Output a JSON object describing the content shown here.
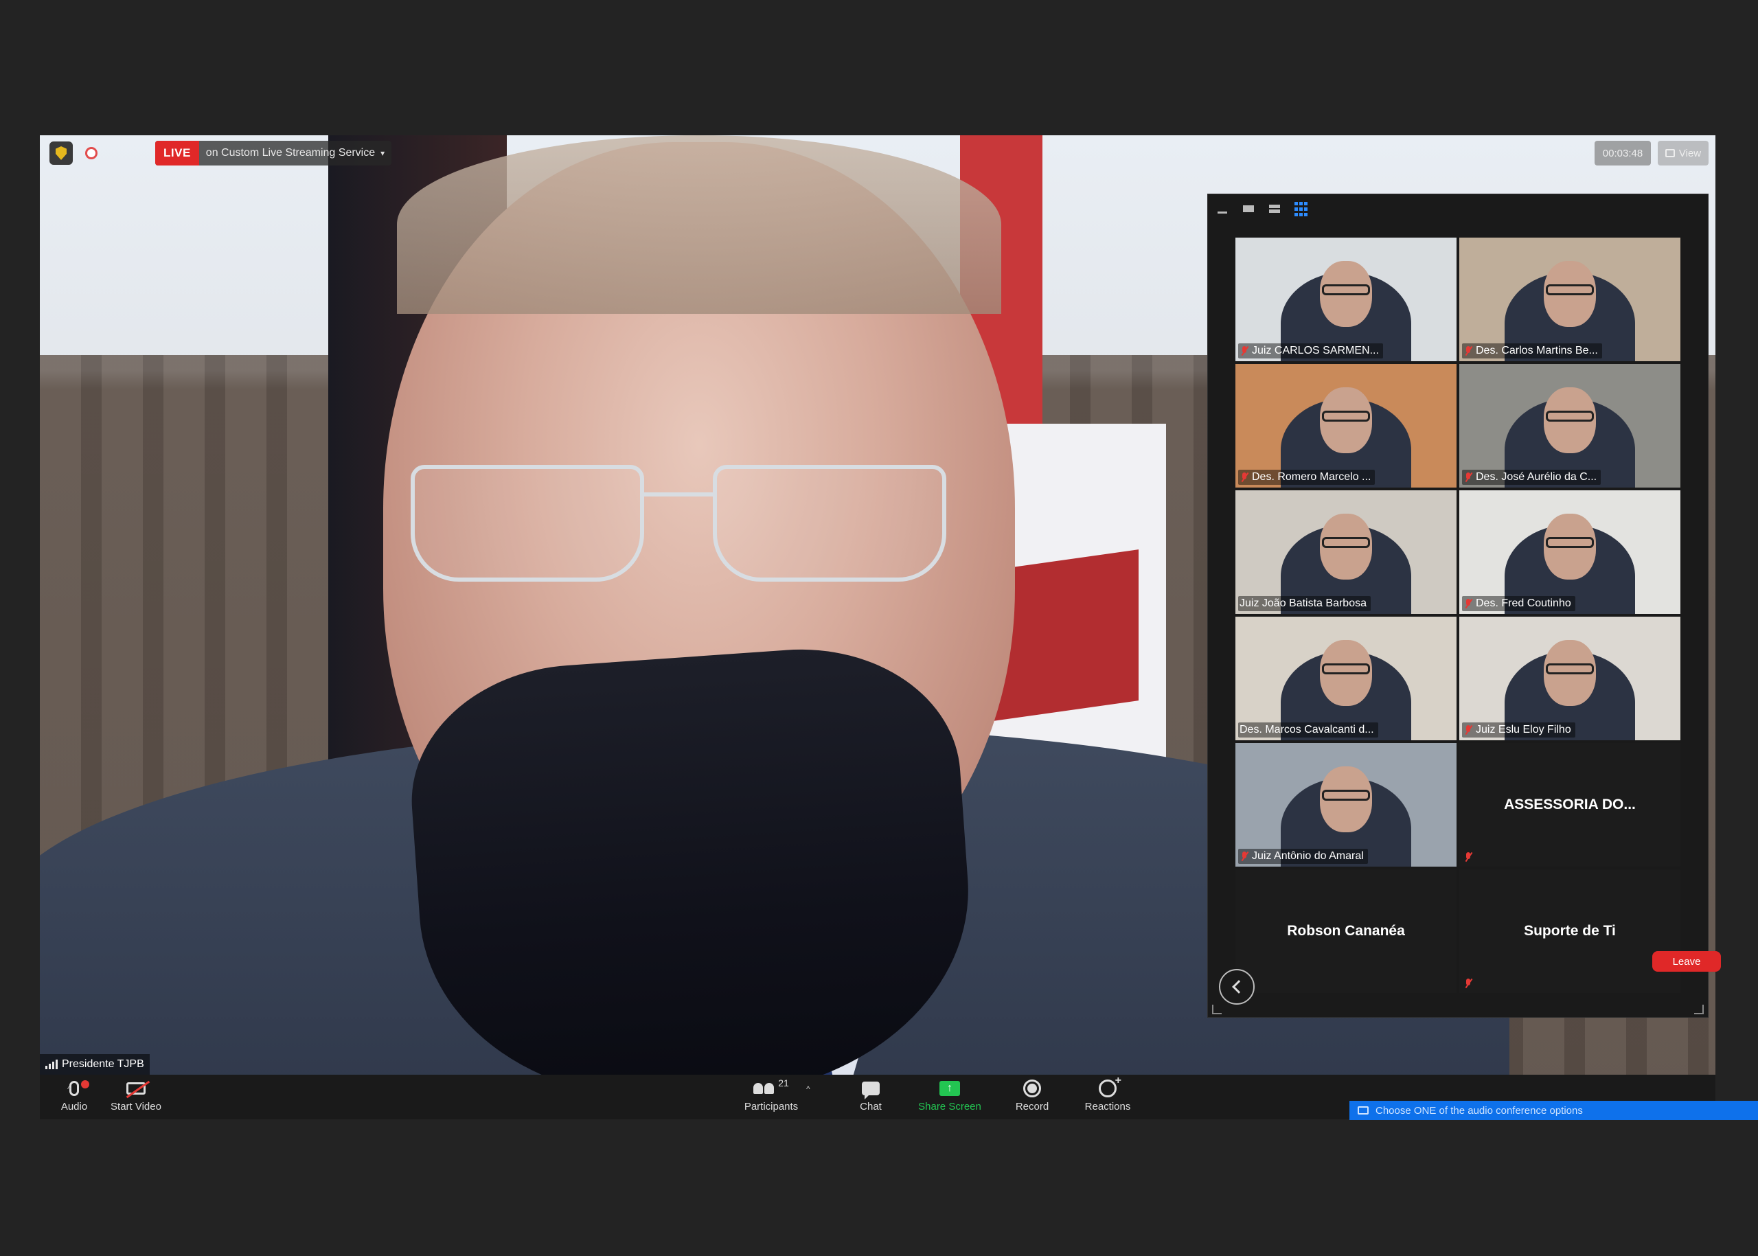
{
  "topbar": {
    "live_label": "LIVE",
    "stream_label": "on Custom Live Streaming Service",
    "caret": "▾",
    "timer": "00:03:48",
    "view_label": "View"
  },
  "main_speaker": {
    "name": "Presidente TJPB"
  },
  "gallery": {
    "participants": [
      {
        "name": "Juiz CARLOS SARMEN...",
        "muted": true,
        "bg": "#d9dde0"
      },
      {
        "name": "Des. Carlos Martins Be...",
        "muted": true,
        "bg": "#bfae9a"
      },
      {
        "name": "Des. Romero Marcelo ...",
        "muted": true,
        "bg": "#c98a5a"
      },
      {
        "name": "Des. José Aurélio da C...",
        "muted": true,
        "bg": "#8d8d88"
      },
      {
        "name": "Juiz João Batista Barbosa",
        "muted": false,
        "bg": "#cfcac2"
      },
      {
        "name": "Des. Fred Coutinho",
        "muted": true,
        "bg": "#e3e3e0"
      },
      {
        "name": "Des. Marcos Cavalcanti d...",
        "muted": false,
        "bg": "#d8d2c8"
      },
      {
        "name": "Juiz Eslu Eloy Filho",
        "muted": true,
        "bg": "#dcd8d2"
      },
      {
        "name": "Juiz Antônio do Amaral",
        "muted": true,
        "bg": "#9aa3ad"
      }
    ],
    "no_video": [
      {
        "name": "ASSESSORIA DO...",
        "muted": true
      },
      {
        "name": "Robson Cananéa",
        "muted": false
      },
      {
        "name": "Suporte de Ti",
        "muted": true
      }
    ]
  },
  "toolbar": {
    "audio_label": "Audio",
    "video_label": "Start Video",
    "participants_label": "Participants",
    "participants_count": "21",
    "chat_label": "Chat",
    "share_label": "Share Screen",
    "record_label": "Record",
    "reactions_label": "Reactions",
    "leave_label": "Leave",
    "caret": "^"
  },
  "audio_banner": {
    "text": "Choose ONE of the audio conference options"
  },
  "colors": {
    "live_red": "#e02828",
    "share_green": "#23c552",
    "accent_blue": "#0e71eb",
    "mute_red": "#e53935"
  }
}
